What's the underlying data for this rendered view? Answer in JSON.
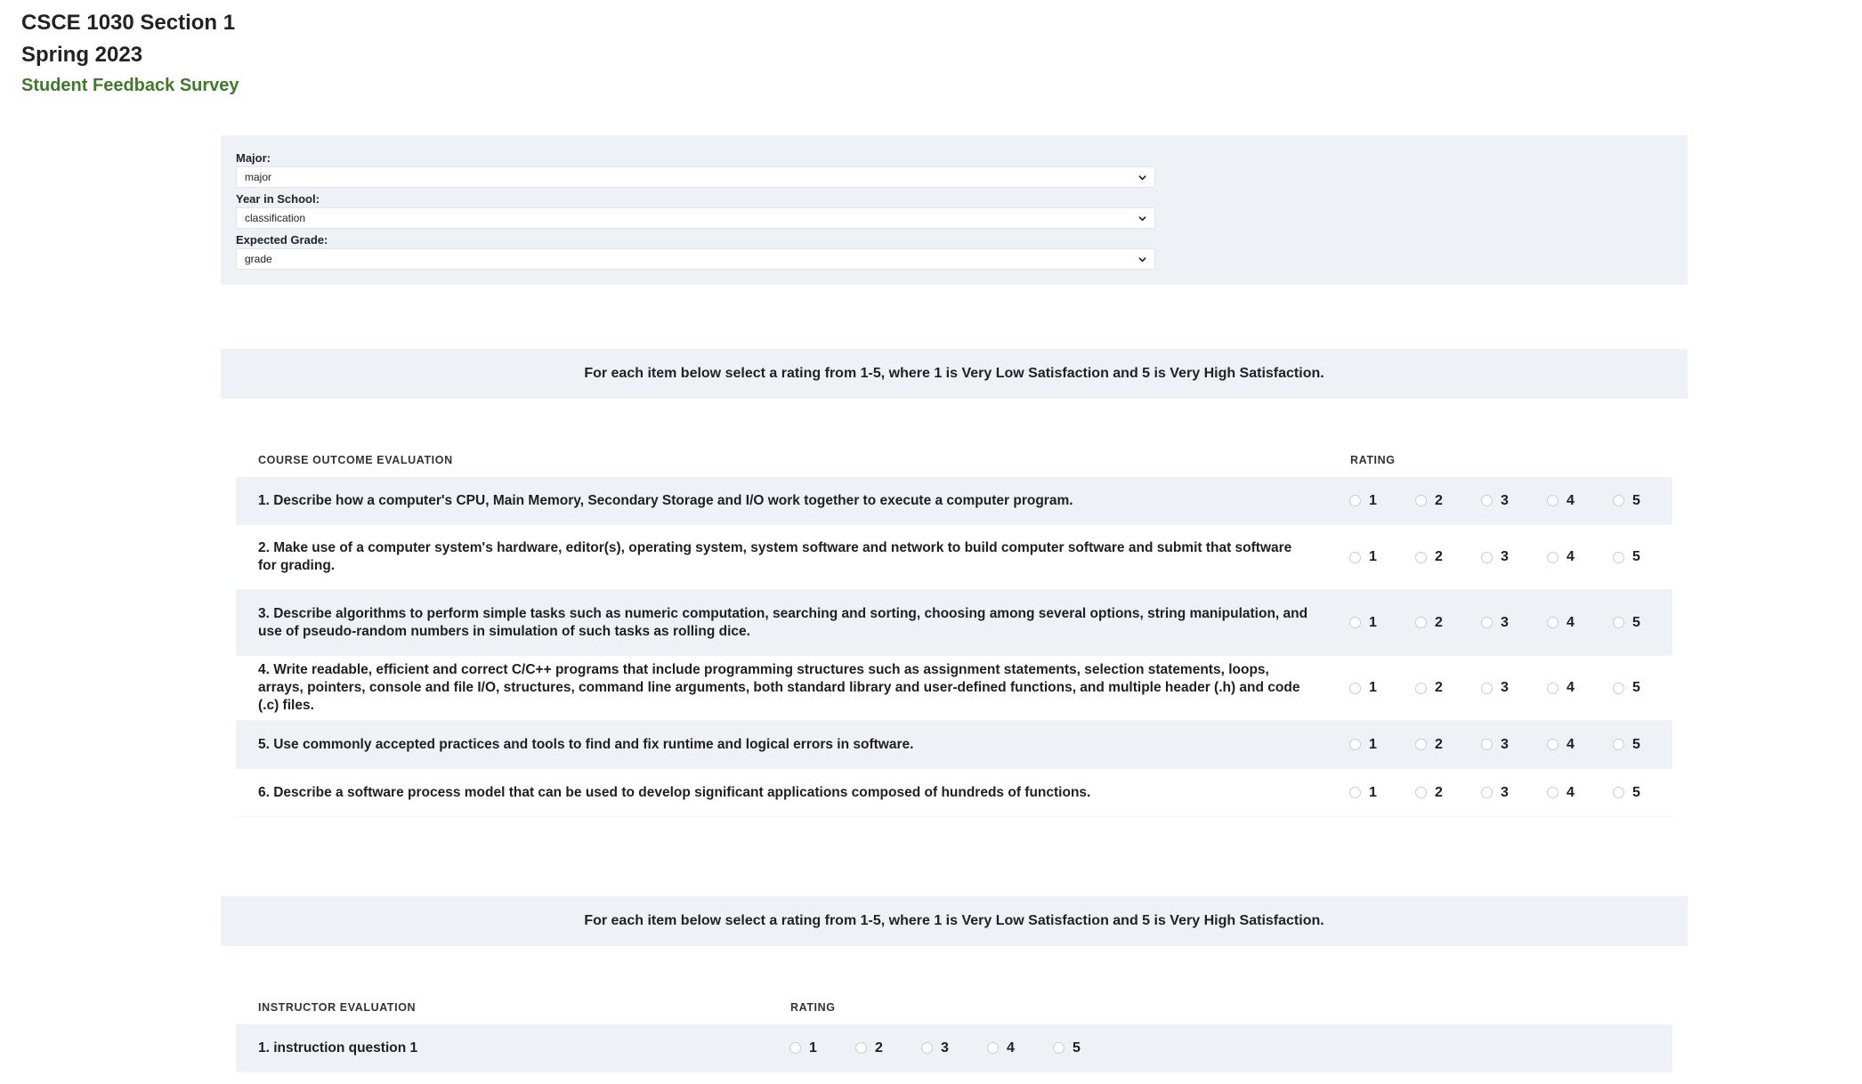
{
  "header": {
    "course": "CSCE 1030 Section 1",
    "term": "Spring 2023",
    "survey_title": "Student Feedback Survey"
  },
  "demographics": {
    "major": {
      "label": "Major:",
      "value": "major"
    },
    "year": {
      "label": "Year in School:",
      "value": "classification"
    },
    "grade": {
      "label": "Expected Grade:",
      "value": "grade"
    }
  },
  "instructions": "For each item below select a rating from 1-5, where 1 is Very Low Satisfaction and 5 is Very High Satisfaction.",
  "rating_options": [
    "1",
    "2",
    "3",
    "4",
    "5"
  ],
  "course_eval": {
    "title": "COURSE OUTCOME EVALUATION",
    "rating_title": "RATING",
    "questions": [
      "1. Describe how a computer's CPU, Main Memory, Secondary Storage and I/O work together to execute a computer program.",
      "2. Make use of a computer system's hardware, editor(s), operating system, system software and network to build computer software and submit that software for grading.",
      "3. Describe algorithms to perform simple tasks such as numeric computation, searching and sorting, choosing among several options, string manipulation, and use of pseudo-random numbers in simulation of such tasks as rolling dice.",
      "4. Write readable, efficient and correct C/C++ programs that include programming structures such as assignment statements, selection statements, loops, arrays, pointers, console and file I/O, structures, command line arguments, both standard library and user-defined functions, and multiple header (.h) and code (.c) files.",
      "5. Use commonly accepted practices and tools to find and fix runtime and logical errors in software.",
      "6. Describe a software process model that can be used to develop significant applications composed of hundreds of functions."
    ]
  },
  "instructor_eval": {
    "title": "INSTRUCTOR EVALUATION",
    "rating_title": "RATING",
    "questions": [
      "1. instruction question 1"
    ]
  }
}
